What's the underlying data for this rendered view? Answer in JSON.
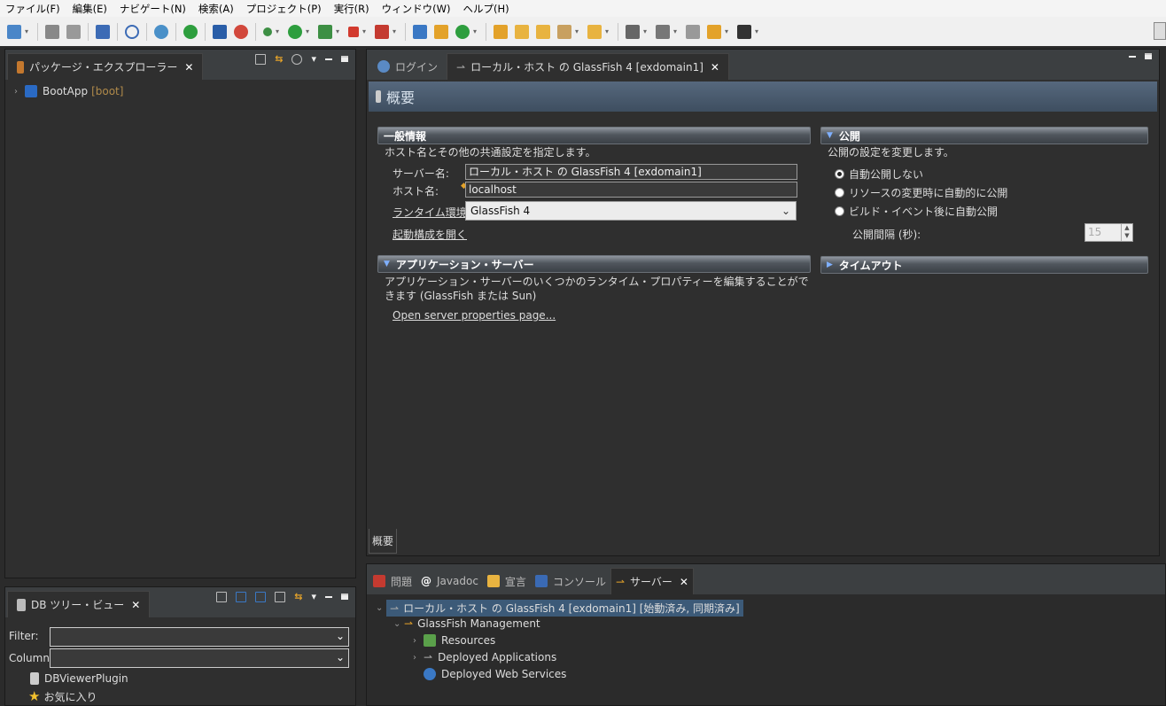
{
  "menu": [
    "ファイル(F)",
    "編集(E)",
    "ナビゲート(N)",
    "検索(A)",
    "プロジェクト(P)",
    "実行(R)",
    "ウィンドウ(W)",
    "ヘルプ(H)"
  ],
  "package_explorer": {
    "tab": "パッケージ・エクスプローラー",
    "project": "BootApp",
    "project_suffix": "[boot]"
  },
  "db_tree": {
    "tab": "DB ツリー・ビュー",
    "filter_label": "Filter:",
    "column_label": "Column:",
    "items": [
      "DBViewerPlugin",
      "お気に入り"
    ]
  },
  "editor": {
    "tabs": [
      "ログイン",
      "ローカル・ホスト の GlassFish 4 [exdomain1]"
    ],
    "header": "概要",
    "general": {
      "title": "一般情報",
      "desc": "ホスト名とその他の共通設定を指定します。",
      "server_name_label": "サーバー名:",
      "server_name": "ローカル・ホスト の GlassFish 4 [exdomain1]",
      "host_label": "ホスト名:",
      "host": "localhost",
      "runtime_label": "ランタイム環境:",
      "runtime": "GlassFish 4",
      "launch_link": "起動構成を開く"
    },
    "publish": {
      "title": "公開",
      "desc": "公開の設定を変更します。",
      "options": [
        "自動公開しない",
        "リソースの変更時に自動的に公開",
        "ビルド・イベント後に自動公開"
      ],
      "selected": 0,
      "interval_label": "公開間隔 (秒):",
      "interval": "15"
    },
    "app_server": {
      "title": "アプリケーション・サーバー",
      "desc": "アプリケーション・サーバーのいくつかのランタイム・プロパティーを編集することができます (GlassFish または Sun)",
      "link": "Open server properties page..."
    },
    "timeout": {
      "title": "タイムアウト"
    },
    "bottom_tab": "概要"
  },
  "bottom_views": {
    "tabs": [
      "問題",
      "Javadoc",
      "宣言",
      "コンソール",
      "サーバー"
    ],
    "tree": [
      "ローカル・ホスト の GlassFish 4 [exdomain1]  [始動済み, 同期済み]",
      "GlassFish Management",
      "Resources",
      "Deployed Applications",
      "Deployed Web Services"
    ]
  }
}
